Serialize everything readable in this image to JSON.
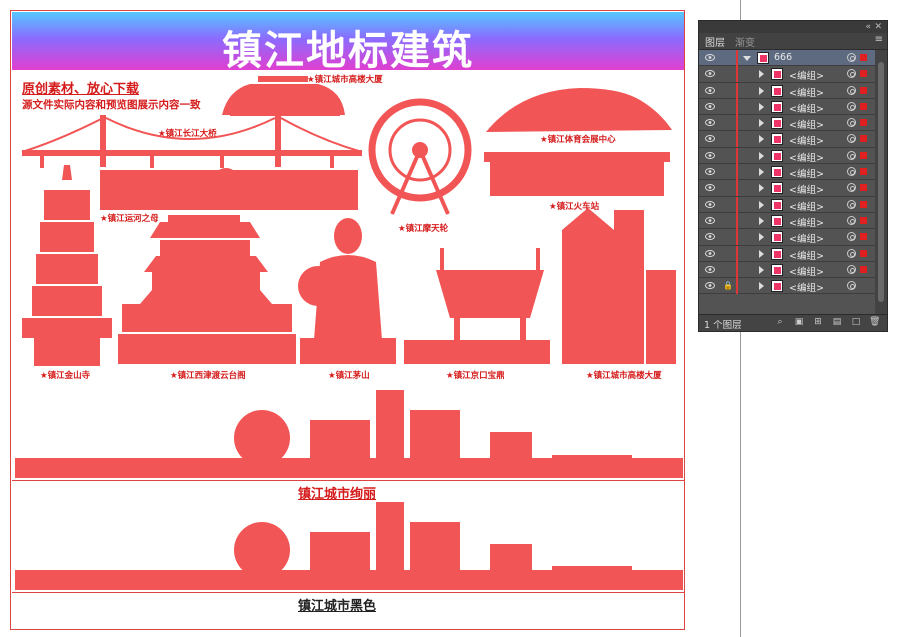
{
  "poster": {
    "title": "镇江地标建筑",
    "promo_line1": "原创素材、放心下载",
    "promo_line2": "源文件实际内容和预览图展示内容一致",
    "skyline_colored_label": "镇江城市绚丽",
    "skyline_black_label": "镇江城市黑色"
  },
  "landmarks": [
    {
      "key": "tower",
      "label": "★镇江城市高楼大厦"
    },
    {
      "key": "bridge",
      "label": "★镇江长江大桥"
    },
    {
      "key": "ferris",
      "label": "★镇江摩天轮"
    },
    {
      "key": "sports",
      "label": "★镇江体育会展中心"
    },
    {
      "key": "station",
      "label": "★镇江火车站"
    },
    {
      "key": "canal",
      "label": "★镇江运河之母"
    },
    {
      "key": "pagoda",
      "label": "★镇江金山寺"
    },
    {
      "key": "pavilion",
      "label": "★镇江西津渡云台阁"
    },
    {
      "key": "maoshan",
      "label": "★镇江茅山"
    },
    {
      "key": "ding",
      "label": "★镇江京口宝鼎"
    },
    {
      "key": "highrise",
      "label": "★镇江城市高楼大厦"
    }
  ],
  "colors": {
    "silhouette": "#f25555",
    "accent_red": "#d51c1c"
  },
  "layers_panel": {
    "tab_layers": "图层",
    "tab_gradient": "渐变",
    "layer_name": "666",
    "group_label": "<编组>",
    "group_count": 14,
    "footer_text": "1 个图层"
  }
}
